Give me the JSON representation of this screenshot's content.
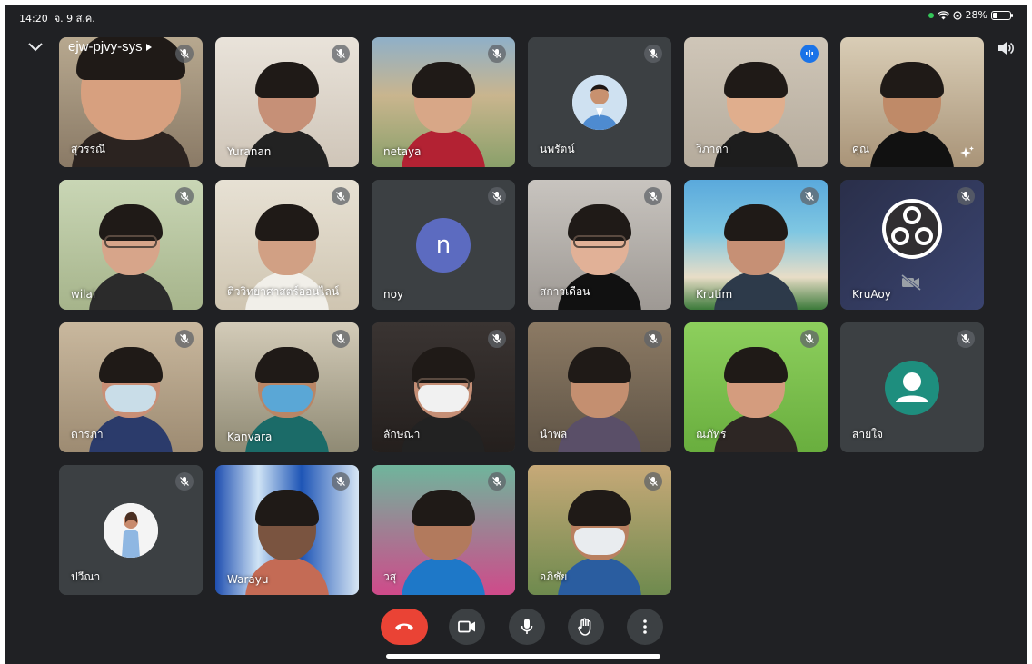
{
  "status_bar": {
    "time": "14:20",
    "date": "จ. 9 ส.ค.",
    "battery": "28%",
    "battery_level": 0.28
  },
  "meeting": {
    "code": "ejw-pjvy-sys"
  },
  "participants": [
    {
      "name": "สุวรรณี"
    },
    {
      "name": "Yuranan"
    },
    {
      "name": "netaya"
    },
    {
      "name": "นพรัตน์"
    },
    {
      "name": "วิภาดา"
    },
    {
      "name": "คุณ"
    },
    {
      "name": "wilai"
    },
    {
      "name": "ติววิทยาศาสตร์ออนไลน์"
    },
    {
      "name": "noy",
      "initial": "n"
    },
    {
      "name": "สกาวเดือน"
    },
    {
      "name": "Krutim"
    },
    {
      "name": "KruAoy"
    },
    {
      "name": "ดารภา"
    },
    {
      "name": "Kanvara"
    },
    {
      "name": "ลักษณา"
    },
    {
      "name": "นำพล"
    },
    {
      "name": "ณภัทร"
    },
    {
      "name": "สายใจ"
    },
    {
      "name": "ปวีณา"
    },
    {
      "name": "Warayu"
    },
    {
      "name": "วสุ"
    },
    {
      "name": "อภิชัย"
    }
  ],
  "colors": {
    "background": "#202124",
    "tile": "#3c4043",
    "end_call": "#ea4335",
    "speaking": "#1a73e8",
    "letter_avatar": "#5c6bc0"
  },
  "icons": {
    "collapse": "chevron-down-icon",
    "camera_switch": "camera-switch-icon",
    "speaker": "speaker-icon",
    "mic_off": "mic-off-icon",
    "end_call": "phone-hangup-icon",
    "camera": "video-camera-icon",
    "mic": "microphone-icon",
    "raise_hand": "raise-hand-icon",
    "more": "more-vertical-icon"
  }
}
